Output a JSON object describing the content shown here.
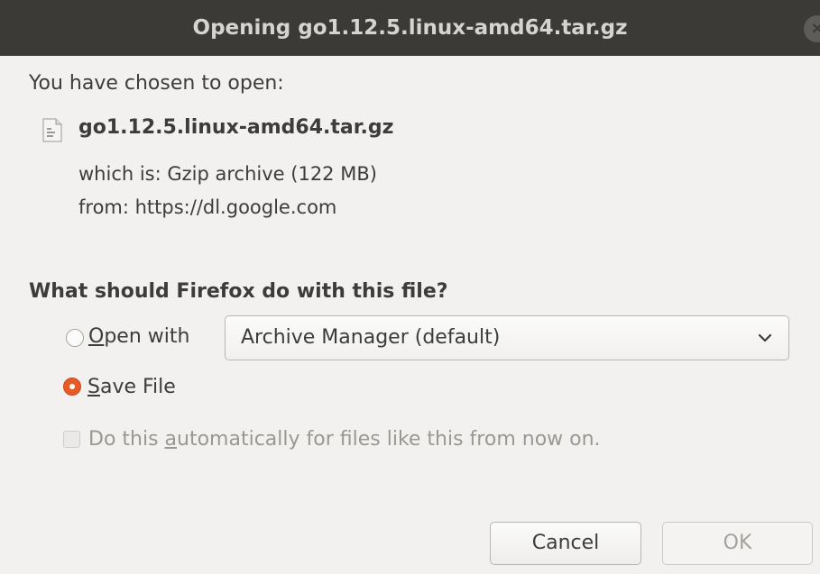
{
  "window": {
    "title": "Opening go1.12.5.linux-amd64.tar.gz",
    "close_glyph": "×"
  },
  "dialog": {
    "prompt": "You have chosen to open:",
    "filename": "go1.12.5.linux-amd64.tar.gz",
    "which_is": "which is: Gzip archive (122 MB)",
    "from": "from: https://dl.google.com",
    "question": "What should Firefox do with this file?"
  },
  "options": {
    "open_with": {
      "mnemonic": "O",
      "rest": "pen with",
      "selected": false
    },
    "open_with_app": {
      "selected_value": "Archive Manager (default)"
    },
    "save_file": {
      "mnemonic": "S",
      "rest": "ave File",
      "selected": true
    },
    "auto": {
      "pre": "Do this ",
      "mnemonic": "a",
      "post": "utomatically for files like this from now on.",
      "checked": false,
      "enabled": false
    }
  },
  "buttons": {
    "cancel": "Cancel",
    "ok": "OK"
  },
  "colors": {
    "titlebar_bg": "#3b3a37",
    "accent_radio": "#e85a26",
    "window_bg": "#f2f1f0"
  },
  "icons": {
    "file": "archive-file-icon",
    "dropdown": "chevron-down-icon",
    "close": "close-icon"
  }
}
